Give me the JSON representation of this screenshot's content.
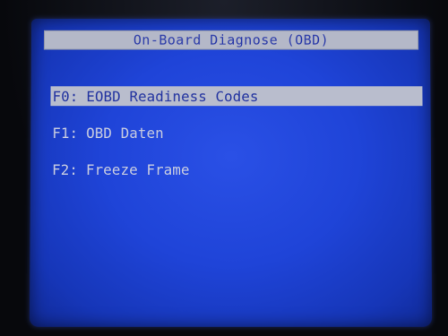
{
  "screen": {
    "title": "On-Board Diagnose (OBD)"
  },
  "menu": {
    "items": [
      {
        "key": "F0:",
        "label": "EOBD Readiness Codes",
        "selected": true
      },
      {
        "key": "F1:",
        "label": "OBD Daten",
        "selected": false
      },
      {
        "key": "F2:",
        "label": "Freeze Frame",
        "selected": false
      }
    ]
  },
  "colors": {
    "screen_background": "#1f44d8",
    "title_bar_background": "#b4b8c8",
    "text": "#c9cde0",
    "selected_text": "#2233a0"
  }
}
